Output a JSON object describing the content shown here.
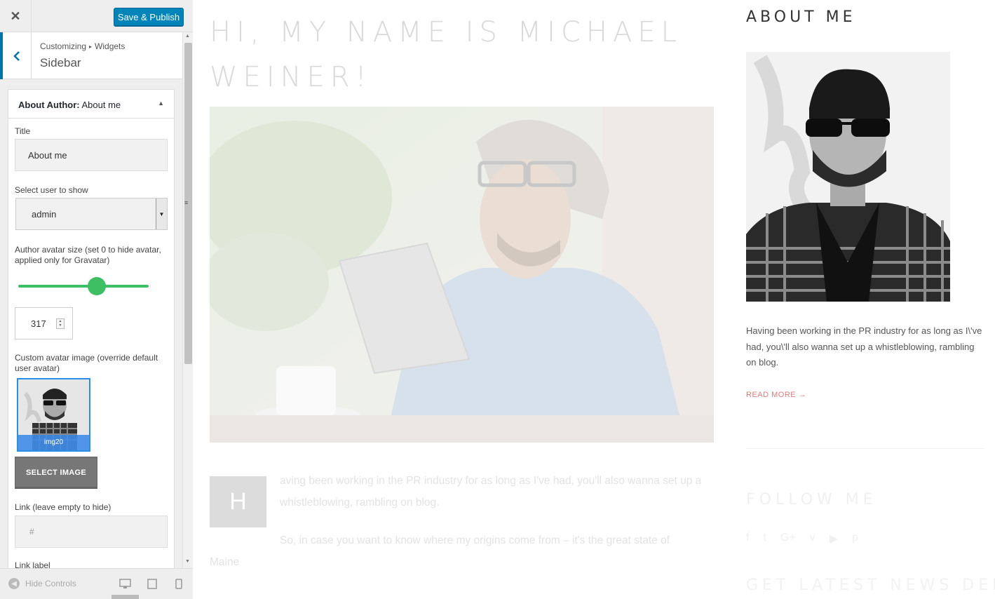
{
  "customizer": {
    "close_label": "✕",
    "save_label": "Save & Publish",
    "back_label": "‹",
    "breadcrumb": {
      "root": "Customizing",
      "separator": "▸",
      "current": "Widgets"
    },
    "section_title": "Sidebar",
    "widget": {
      "type": "About Author:",
      "name": "About me",
      "fields": {
        "title_label": "Title",
        "title_value": "About me",
        "user_label": "Select user to show",
        "user_value": "admin",
        "avatar_size_label": "Author avatar size (set 0 to hide avatar, applied only for Gravatar)",
        "avatar_size_value": "317",
        "avatar_size_slider_fraction": 0.6,
        "custom_avatar_label": "Custom avatar image (override default user avatar)",
        "custom_avatar_caption": "img20",
        "select_image_label": "SELECT IMAGE",
        "link_label": "Link (leave empty to hide)",
        "link_value": "#",
        "link_text_label": "Link label"
      }
    },
    "footer": {
      "hide_controls_label": "Hide Controls"
    }
  },
  "preview": {
    "hero_title": "HI, MY NAME IS MICHAEL WEINER!",
    "dropcap": "H",
    "para1": "aving been working in the PR industry for as long as I've had, you'll also wanna set up a whistleblowing, rambling on blog.",
    "para2_line1": "So, in case you want to know where my origins come from – it's the great state of",
    "para2_line2": "Maine",
    "sidebar": {
      "about_title": "ABOUT ME",
      "about_text": "Having been working in the PR industry for as long as I\\'ve had, you\\'ll also wanna set up a whistleblowing, rambling on blog.",
      "read_more": "READ MORE",
      "follow_title": "FOLLOW ME",
      "social": [
        "facebook-icon",
        "twitter-icon",
        "google-plus-icon",
        "vimeo-icon",
        "youtube-icon",
        "pinterest-icon"
      ],
      "news_title": "GET LATEST NEWS DELIV-"
    }
  },
  "colors": {
    "primary_button": "#0085ba",
    "slider": "#3cc063",
    "accent_link": "#e07a7a"
  }
}
